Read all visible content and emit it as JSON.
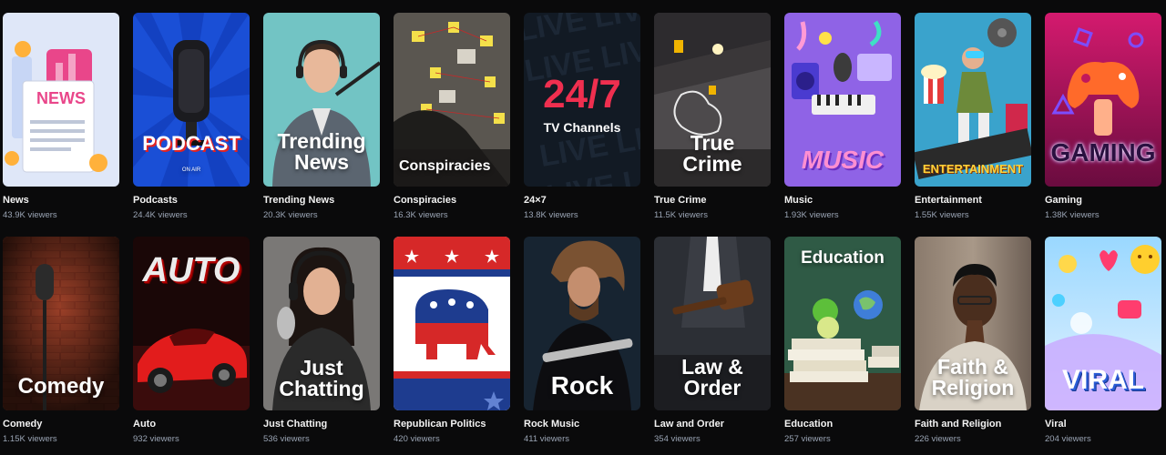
{
  "categories": [
    {
      "name": "News",
      "viewers": "43.9K viewers",
      "overlay": "NEWS",
      "bg": "#dde6f7"
    },
    {
      "name": "Podcasts",
      "viewers": "24.4K viewers",
      "overlay": "PODCAST",
      "sub": "ON AIR",
      "bg": "#1a4fd6"
    },
    {
      "name": "Trending News",
      "viewers": "20.3K viewers",
      "overlay": "Trending News",
      "bg": "#6fbfc0"
    },
    {
      "name": "Conspiracies",
      "viewers": "16.3K viewers",
      "overlay": "Conspiracies",
      "bg": "#3b3a38"
    },
    {
      "name": "24×7",
      "viewers": "13.8K viewers",
      "overlay": "24/7",
      "sub": "TV Channels",
      "bg": "#151b26"
    },
    {
      "name": "True Crime",
      "viewers": "11.5K viewers",
      "overlay": "True Crime",
      "bg": "#3c3a3d"
    },
    {
      "name": "Music",
      "viewers": "1.93K viewers",
      "overlay": "MUSIC",
      "bg": "#8a5be0"
    },
    {
      "name": "Entertainment",
      "viewers": "1.55K viewers",
      "overlay": "ENTERTAINMENT",
      "bg": "#3fa0c8"
    },
    {
      "name": "Gaming",
      "viewers": "1.38K viewers",
      "overlay": "GAMING",
      "bg": "#c81c7a"
    },
    {
      "name": "Comedy",
      "viewers": "1.15K viewers",
      "overlay": "Comedy",
      "bg": "#7a2d1d"
    },
    {
      "name": "Auto",
      "viewers": "932 viewers",
      "overlay": "AUTO",
      "bg": "#2a0e0e"
    },
    {
      "name": "Just Chatting",
      "viewers": "536 viewers",
      "overlay": "Just Chatting",
      "bg": "#6a6a6a"
    },
    {
      "name": "Republican Politics",
      "viewers": "420 viewers",
      "bg": "#d62a2a"
    },
    {
      "name": "Rock Music",
      "viewers": "411 viewers",
      "overlay": "Rock",
      "bg": "#1c2a33"
    },
    {
      "name": "Law and Order",
      "viewers": "354 viewers",
      "overlay": "Law & Order",
      "bg": "#2e3036"
    },
    {
      "name": "Education",
      "viewers": "257 viewers",
      "overlay": "Education",
      "bg": "#2d5a44"
    },
    {
      "name": "Faith and Religion",
      "viewers": "226 viewers",
      "overlay": "Faith & Religion",
      "bg": "#6d5f55"
    },
    {
      "name": "Viral",
      "viewers": "204 viewers",
      "overlay": "VIRAL",
      "bg": "#5fb3f0"
    }
  ]
}
